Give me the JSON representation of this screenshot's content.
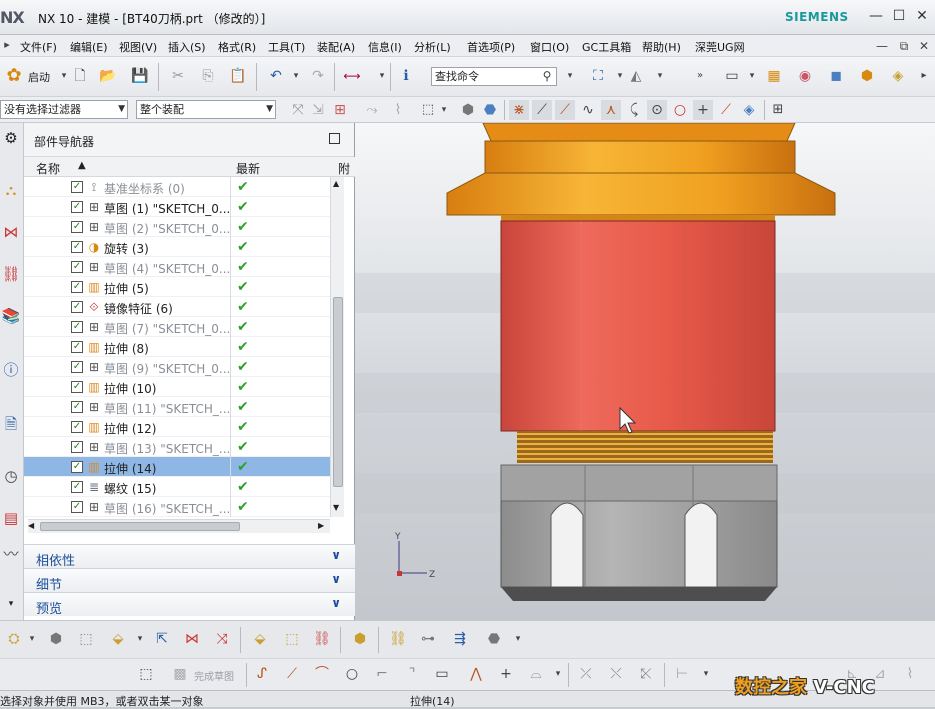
{
  "titlebar": {
    "logo": "NX",
    "title": "NX 10 - 建模 - [BT40刀柄.prt （修改的）]",
    "brand": "SIEMENS",
    "controls": [
      "—",
      "☐",
      "✕"
    ]
  },
  "menubar": {
    "items": [
      "文件(F)",
      "编辑(E)",
      "视图(V)",
      "插入(S)",
      "格式(R)",
      "工具(T)",
      "装配(A)",
      "信息(I)",
      "分析(L)",
      "首选项(P)",
      "窗口(O)",
      "GC工具箱",
      "帮助(H)",
      "深莞UG网"
    ]
  },
  "toolbar1": {
    "start_label": "启动",
    "search_placeholder": "查找命令"
  },
  "toolbar2": {
    "filter_label": "没有选择过滤器",
    "scope_label": "整个装配"
  },
  "navigator": {
    "title": "部件导航器",
    "col_name": "名称",
    "col_latest": "最新",
    "col_extra": "附",
    "rows": [
      {
        "icon": "datum-csys-icon",
        "label": "基准坐标系 (0)",
        "dim": true,
        "selected": false
      },
      {
        "icon": "sketch-icon",
        "label": "草图 (1) \"SKETCH_0...",
        "dim": false,
        "selected": false
      },
      {
        "icon": "sketch-icon",
        "label": "草图 (2) \"SKETCH_0...",
        "dim": true,
        "selected": false
      },
      {
        "icon": "revolve-icon",
        "label": "旋转 (3)",
        "dim": false,
        "selected": false
      },
      {
        "icon": "sketch-icon",
        "label": "草图 (4) \"SKETCH_0...",
        "dim": true,
        "selected": false
      },
      {
        "icon": "extrude-icon",
        "label": "拉伸 (5)",
        "dim": false,
        "selected": false
      },
      {
        "icon": "mirror-icon",
        "label": "镜像特征 (6)",
        "dim": false,
        "selected": false
      },
      {
        "icon": "sketch-icon",
        "label": "草图 (7) \"SKETCH_0...",
        "dim": true,
        "selected": false
      },
      {
        "icon": "extrude-icon",
        "label": "拉伸 (8)",
        "dim": false,
        "selected": false
      },
      {
        "icon": "sketch-icon",
        "label": "草图 (9) \"SKETCH_0...",
        "dim": true,
        "selected": false
      },
      {
        "icon": "extrude-icon",
        "label": "拉伸 (10)",
        "dim": false,
        "selected": false
      },
      {
        "icon": "sketch-icon",
        "label": "草图 (11) \"SKETCH_...",
        "dim": true,
        "selected": false
      },
      {
        "icon": "extrude-icon",
        "label": "拉伸 (12)",
        "dim": false,
        "selected": false
      },
      {
        "icon": "sketch-icon",
        "label": "草图 (13) \"SKETCH_...",
        "dim": true,
        "selected": false
      },
      {
        "icon": "extrude-icon",
        "label": "拉伸 (14)",
        "dim": false,
        "selected": true
      },
      {
        "icon": "thread-icon",
        "label": "螺纹 (15)",
        "dim": false,
        "selected": false
      },
      {
        "icon": "sketch-icon",
        "label": "草图 (16) \"SKETCH_...",
        "dim": true,
        "selected": false
      }
    ],
    "sections": [
      "相依性",
      "细节",
      "预览"
    ]
  },
  "toolbar4": {
    "finish_sketch_label": "完成草图"
  },
  "statusbar": {
    "message": "选择对象并使用 MB3，或者双击某一对象",
    "current": "拉伸(14)"
  },
  "watermark": {
    "text1": "数控之家 ",
    "text2": "V-CNC"
  },
  "colors": {
    "flange": "#f0a020",
    "body": "#e85a4a",
    "thread": "#c9891f",
    "nut": "#9e9e9e",
    "selected_row": "#8fb7e6",
    "section_text": "#1b4f9a"
  }
}
